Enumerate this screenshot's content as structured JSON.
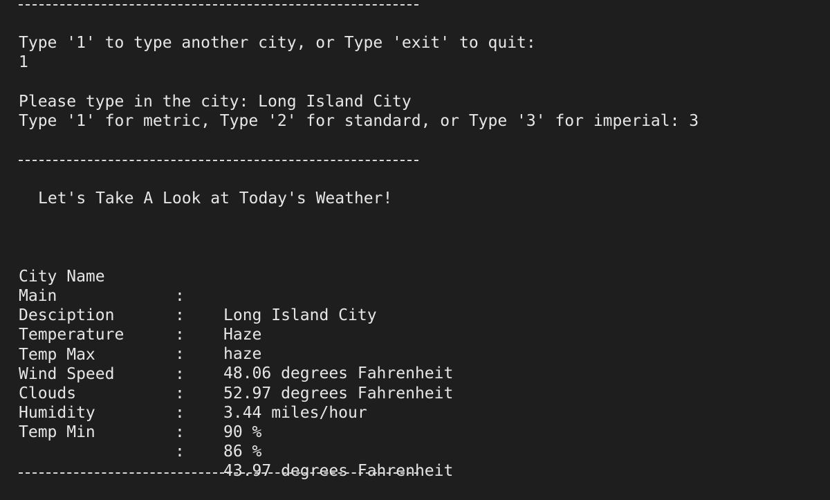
{
  "prompts": {
    "choice_prompt": "Type '1' to type another city, or Type 'exit' to quit:",
    "choice_input": "1",
    "city_prompt": "Please type in the city: Long Island City",
    "units_prompt": "Type '1' for metric, Type '2' for standard, or Type '3' for imperial: 3"
  },
  "heading": "Let's Take A Look at Today's Weather!",
  "separator": ":",
  "weather": [
    {
      "label": "City Name",
      "value": "Long Island City"
    },
    {
      "label": "Main",
      "value": "Haze"
    },
    {
      "label": "Desciption",
      "value": "haze"
    },
    {
      "label": "Temperature",
      "value": "48.06 degrees Fahrenheit"
    },
    {
      "label": "Temp Max",
      "value": "52.97 degrees Fahrenheit"
    },
    {
      "label": "Wind Speed",
      "value": "3.44 miles/hour"
    },
    {
      "label": "Clouds",
      "value": "90 %"
    },
    {
      "label": "Humidity",
      "value": "86 %"
    },
    {
      "label": "Temp Min",
      "value": "43.97 degrees Fahrenheit"
    }
  ]
}
